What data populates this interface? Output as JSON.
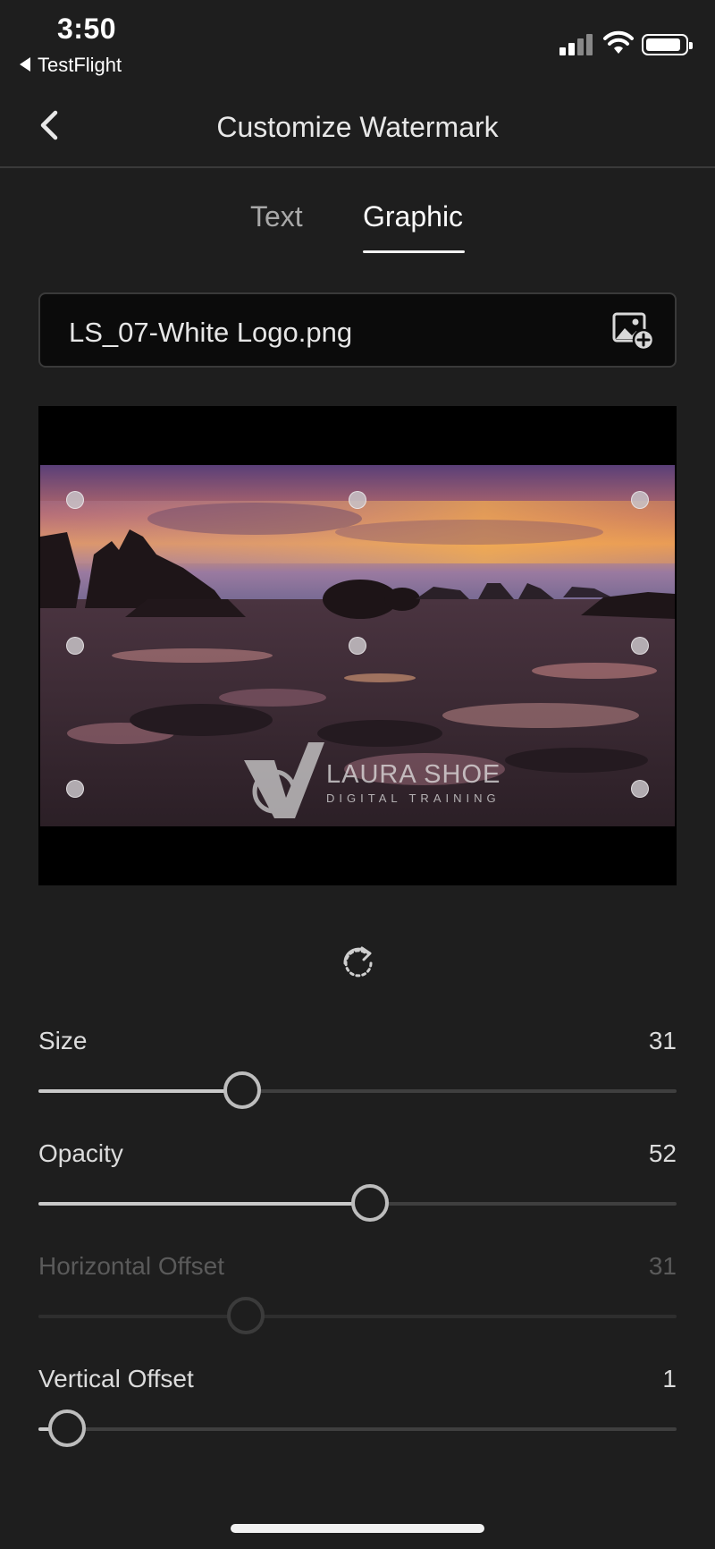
{
  "status_bar": {
    "time": "3:50",
    "back_app": "TestFlight"
  },
  "nav": {
    "title": "Customize Watermark",
    "back_icon": "chevron-left-icon"
  },
  "tabs": [
    {
      "label": "Text",
      "active": false
    },
    {
      "label": "Graphic",
      "active": true
    }
  ],
  "graphic_file": {
    "name": "LS_07-White Logo.png",
    "icon": "add-image-icon"
  },
  "preview": {
    "watermark_line1": "LAURA SHOE",
    "watermark_line2": "DIGITAL TRAINING",
    "selected_anchor": "bottom-center"
  },
  "sliders": [
    {
      "label": "Size",
      "value": "31",
      "fraction": 0.319,
      "enabled": true
    },
    {
      "label": "Opacity",
      "value": "52",
      "fraction": 0.52,
      "enabled": true
    },
    {
      "label": "Horizontal Offset",
      "value": "31",
      "fraction": 0.325,
      "enabled": false
    },
    {
      "label": "Vertical Offset",
      "value": "1",
      "fraction": 0.045,
      "enabled": true
    }
  ],
  "colors": {
    "background": "#1e1e1e",
    "accent": "#f2f2f2"
  }
}
